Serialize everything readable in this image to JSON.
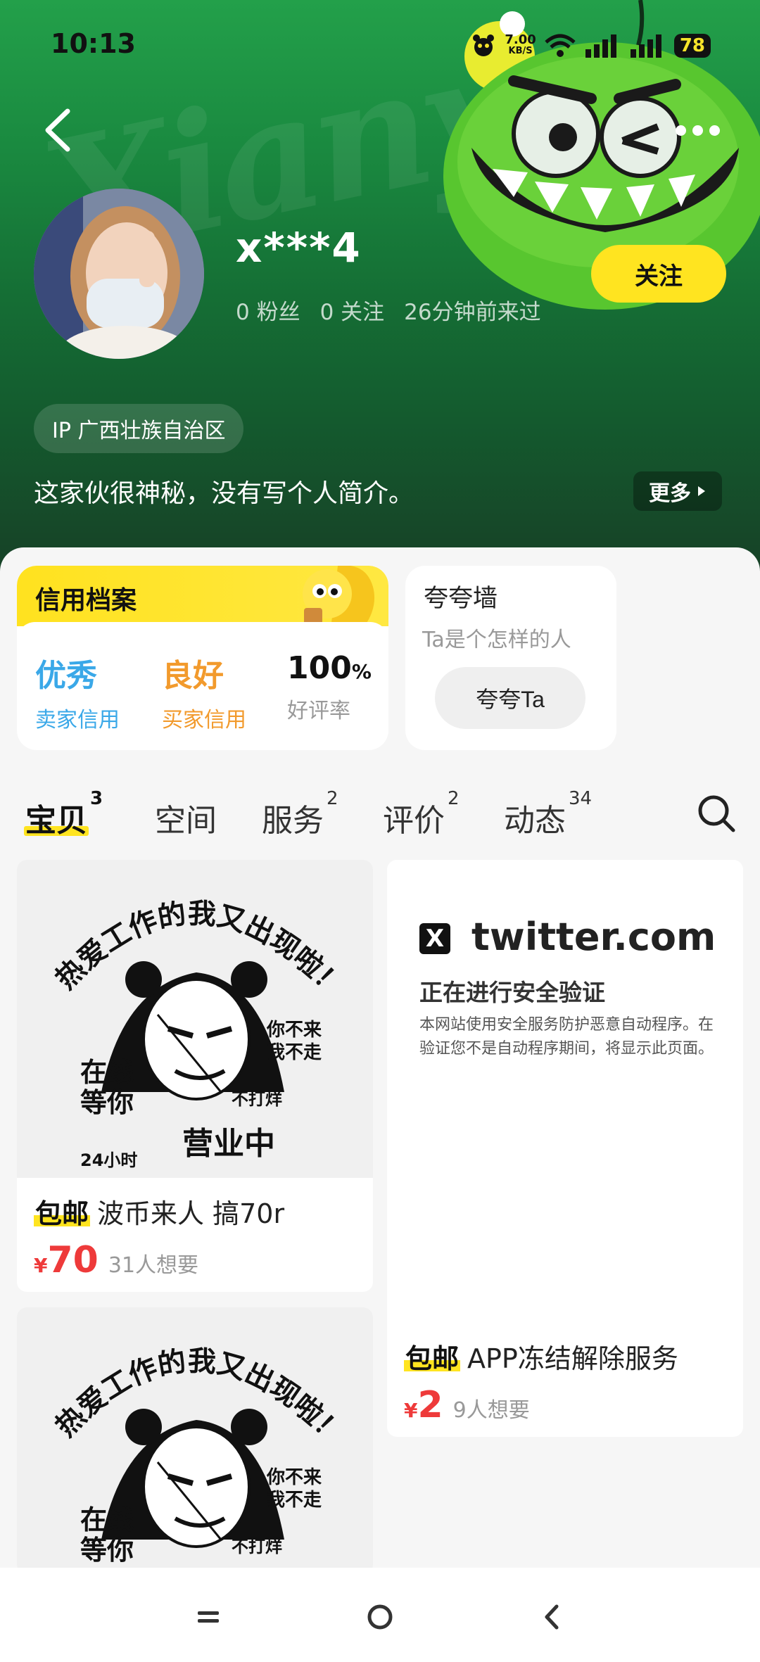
{
  "status_bar": {
    "time": "10:13",
    "net_speed": "7.00",
    "net_unit": "KB/S",
    "battery": "78"
  },
  "profile": {
    "watermark": "Xianyu",
    "username": "x***4",
    "fans": "0 粉丝",
    "following": "0 关注",
    "last_seen": "26分钟前来过",
    "follow_label": "关注",
    "ip_location": "IP 广西壮族自治区",
    "bio": "这家伙很神秘，没有写个人简介。",
    "more_label": "更多"
  },
  "credit": {
    "title": "信用档案",
    "seller_value": "优秀",
    "seller_label": "卖家信用",
    "buyer_value": "良好",
    "buyer_label": "买家信用",
    "rating_value": "100",
    "rating_unit": "%",
    "rating_label": "好评率"
  },
  "praise": {
    "title": "夸夸墙",
    "subtitle": "Ta是个怎样的人",
    "button": "夸夸Ta"
  },
  "tabs": [
    {
      "label": "宝贝",
      "count": "3"
    },
    {
      "label": "空间",
      "count": ""
    },
    {
      "label": "服务",
      "count": "2"
    },
    {
      "label": "评价",
      "count": "2"
    },
    {
      "label": "动态",
      "count": "34"
    }
  ],
  "meme": {
    "arc_text": "热爱工作的我又出现啦！",
    "left_text_1": "在线",
    "left_text_2": "等你",
    "right_text_1": "你不来",
    "right_text_2": "我不走",
    "small": "不打烊",
    "hours": "24小时",
    "open": "营业中"
  },
  "products": [
    {
      "tag": "包邮",
      "title": "波币来人 搞70r",
      "currency": "¥",
      "price": "70",
      "wants": "31人想要"
    },
    {
      "tag": "包邮",
      "title": "APP冻结解除服务",
      "currency": "¥",
      "price": "2",
      "wants": "9人想要"
    }
  ],
  "twitter_preview": {
    "logo": "X",
    "domain": "twitter.com",
    "heading": "正在进行安全验证",
    "desc": "本网站使用安全服务防护恶意自动程序。在验证您不是自动程序期间，将显示此页面。"
  },
  "colors": {
    "brand_yellow": "#ffe420",
    "header_green": "#1a8a40",
    "price_red": "#ee3a3a",
    "seller_blue": "#3aa8e8",
    "buyer_orange": "#f29a2c"
  }
}
